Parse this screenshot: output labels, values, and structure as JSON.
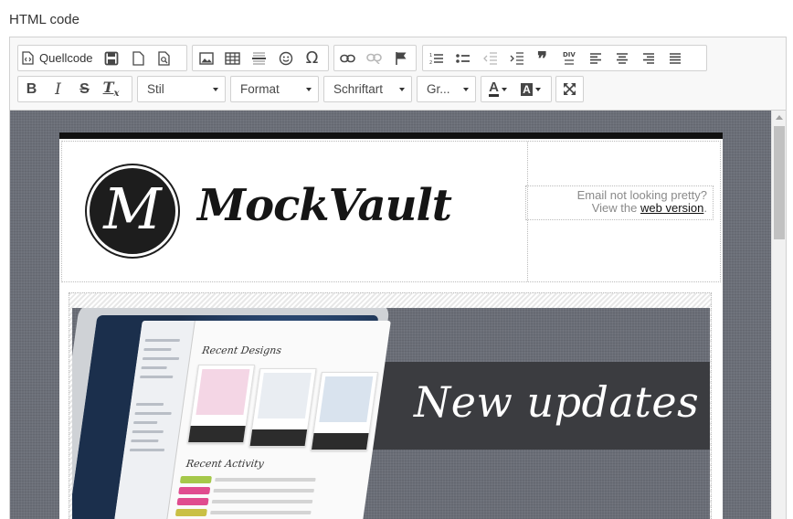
{
  "page": {
    "label": "HTML code"
  },
  "toolbar": {
    "row1": {
      "source_label": "Quellcode",
      "buttons": [
        "save-icon",
        "new-page-icon",
        "preview-icon",
        "image-icon",
        "table-icon",
        "horizontal-line-icon",
        "smiley-icon",
        "special-char-icon",
        "link-icon",
        "unlink-icon",
        "anchor-icon",
        "numbered-list-icon",
        "bulleted-list-icon",
        "outdent-icon",
        "indent-icon",
        "blockquote-icon",
        "div-icon",
        "align-left-icon",
        "align-center-icon",
        "align-right-icon",
        "justify-icon"
      ]
    },
    "row2": {
      "style_combo": "Stil",
      "format_combo": "Format",
      "font_combo": "Schriftart",
      "size_combo": "Gr...",
      "buttons": [
        "bold-icon",
        "italic-icon",
        "strikethrough-icon",
        "remove-format-icon",
        "text-color-icon",
        "background-color-icon",
        "maximize-icon"
      ]
    },
    "glyphs": {
      "bold": "B",
      "italic": "I",
      "strike": "S",
      "clear": "T",
      "clear_sub": "x",
      "text_color": "A",
      "bg_color": "A",
      "omega": "Ω",
      "quote": "❞",
      "div": "DIV"
    }
  },
  "email": {
    "logo_letter": "M",
    "logo_text": "MockVault",
    "weblink_text": "Email not looking pretty?",
    "weblink_prefix": "View the",
    "weblink_link": "web version",
    "weblink_suffix": ".",
    "banner_title": "New updates",
    "app_heading_1": "Recent Designs",
    "app_heading_2": "Recent Activity"
  },
  "colors": {
    "accent_dark": "#111111",
    "banner_stripe": "#3b3c40",
    "background_linen": "#6b6f78"
  }
}
